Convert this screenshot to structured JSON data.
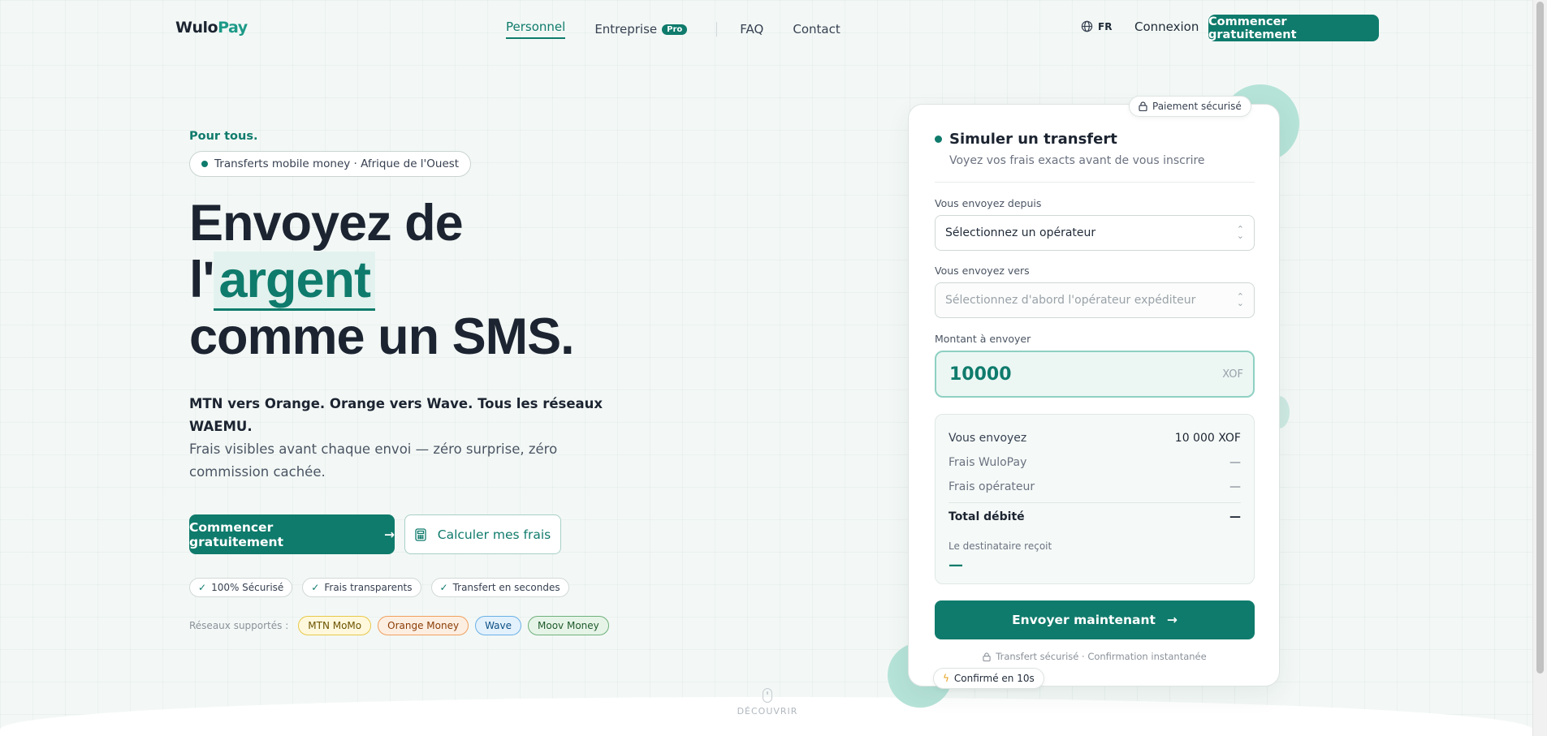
{
  "brand": {
    "part1": "Wulo",
    "part2": "Pay"
  },
  "nav": {
    "items": [
      {
        "label": "Personnel"
      },
      {
        "label": "Entreprise",
        "badge": "Pro"
      },
      {
        "label": "FAQ"
      },
      {
        "label": "Contact"
      }
    ],
    "language": "FR",
    "login": "Connexion",
    "cta": "Commencer gratuitement"
  },
  "hero": {
    "eyebrow": "Pour tous.",
    "tag": "Transferts mobile money · Afrique de l'Ouest",
    "title_line1": "Envoyez de",
    "title_prefix": "l'",
    "title_highlight": "argent",
    "title_line3": "comme un SMS.",
    "lead_strong": "MTN vers Orange. Orange vers Wave. Tous les réseaux WAEMU.",
    "lead_text": "Frais visibles avant chaque envoi — zéro surprise, zéro commission cachée.",
    "primary_cta": "Commencer gratuitement",
    "secondary_cta": "Calculer mes frais",
    "trust": [
      "100% Sécurisé",
      "Frais transparents",
      "Transfert en secondes"
    ],
    "networks_label": "Réseaux supportés :",
    "networks": [
      "MTN MoMo",
      "Orange Money",
      "Wave",
      "Moov Money"
    ],
    "discover": "DÉCOUVRIR"
  },
  "simulator": {
    "secure_badge": "Paiement sécurisé",
    "title": "Simuler un transfert",
    "subtitle": "Voyez vos frais exacts avant de vous inscrire",
    "from_label": "Vous envoyez depuis",
    "from_value": "Sélectionnez un opérateur",
    "to_label": "Vous envoyez vers",
    "to_placeholder": "Sélectionnez d'abord l'opérateur expéditeur",
    "amount_label": "Montant à envoyer",
    "amount_value": "10000",
    "currency": "XOF",
    "summary": {
      "send_label": "Vous envoyez",
      "send_value": "10 000 XOF",
      "fee_wulopay_label": "Frais WuloPay",
      "fee_wulopay_value": "—",
      "fee_operator_label": "Frais opérateur",
      "fee_operator_value": "—",
      "total_label": "Total débité",
      "total_value": "—",
      "receive_label": "Le destinataire reçoit",
      "receive_value": "—"
    },
    "send_button": "Envoyer maintenant",
    "footer": "Transfert sécurisé · Confirmation instantanée",
    "confirm_badge": "Confirmé en 10s"
  },
  "colors": {
    "primary": "#0f7b6c",
    "accent": "#1d9a88",
    "ink": "#1c2431"
  }
}
